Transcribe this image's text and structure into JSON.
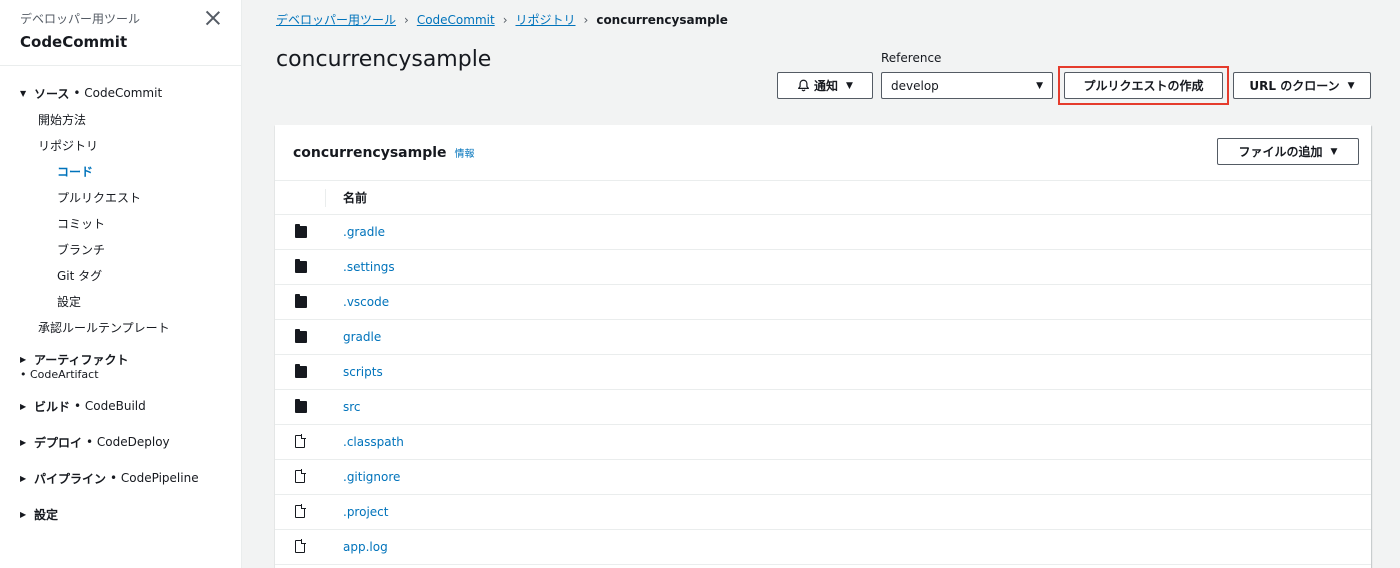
{
  "sidebar": {
    "category": "デベロッパー用ツール",
    "title": "CodeCommit",
    "source": {
      "label": "ソース",
      "service": "• CodeCommit"
    },
    "items": {
      "getting_started": "開始方法",
      "repositories": "リポジトリ",
      "code": "コード",
      "pull_requests": "プルリクエスト",
      "commits": "コミット",
      "branches": "ブランチ",
      "git_tags": "Git タグ",
      "settings_sub": "設定",
      "approval_templates": "承認ルールテンプレート"
    },
    "artifacts": {
      "label": "アーティファクト",
      "service": "• CodeArtifact"
    },
    "build": {
      "label": "ビルド",
      "service": "• CodeBuild"
    },
    "deploy": {
      "label": "デプロイ",
      "service": "• CodeDeploy"
    },
    "pipeline": {
      "label": "パイプライン",
      "service": "• CodePipeline"
    },
    "settings": {
      "label": "設定"
    },
    "expand_glyph": "▶",
    "collapse_glyph": "▼"
  },
  "breadcrumb": {
    "items": [
      "デベロッパー用ツール",
      "CodeCommit",
      "リポジトリ"
    ],
    "current": "concurrencysample",
    "separator": "›"
  },
  "header": {
    "title": "concurrencysample",
    "reference_label": "Reference",
    "notify_label": "通知",
    "notify_icon": "bell-icon",
    "branch_value": "develop",
    "create_pr_label": "プルリクエストの作成",
    "clone_url_label": "URL のクローン",
    "caret": "▼"
  },
  "panel": {
    "title": "concurrencysample",
    "info": "情報",
    "add_file_label": "ファイルの追加",
    "column_name": "名前",
    "files": [
      {
        "name": ".gradle",
        "type": "folder"
      },
      {
        "name": ".settings",
        "type": "folder"
      },
      {
        "name": ".vscode",
        "type": "folder"
      },
      {
        "name": "gradle",
        "type": "folder"
      },
      {
        "name": "scripts",
        "type": "folder"
      },
      {
        "name": "src",
        "type": "folder"
      },
      {
        "name": ".classpath",
        "type": "file"
      },
      {
        "name": ".gitignore",
        "type": "file"
      },
      {
        "name": ".project",
        "type": "file"
      },
      {
        "name": "app.log",
        "type": "file"
      }
    ]
  },
  "colors": {
    "link": "#0073bb",
    "highlight": "#e53b2c",
    "text": "#16191f",
    "background": "#f2f3f3"
  }
}
